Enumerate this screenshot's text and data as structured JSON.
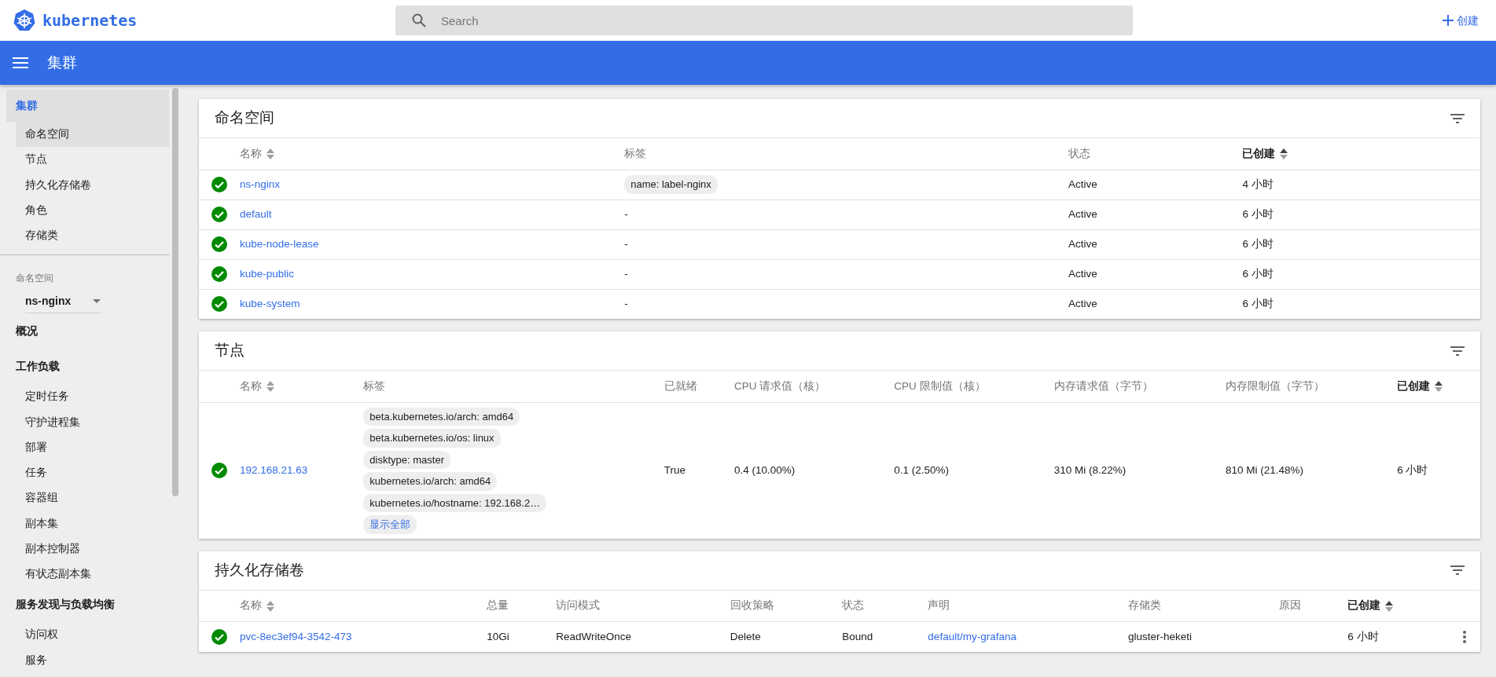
{
  "header": {
    "logo": "kubernetes",
    "search": {
      "placeholder": "Search"
    },
    "create_button": "创建"
  },
  "toolbar": {
    "title": "集群"
  },
  "sidebar": {
    "cluster": {
      "label": "集群",
      "selected": true,
      "items": [
        {
          "label": "命名空间",
          "selected": true
        },
        {
          "label": "节点",
          "selected": false
        },
        {
          "label": "持久化存储卷",
          "selected": false
        },
        {
          "label": "角色",
          "selected": false
        },
        {
          "label": "存储类",
          "selected": false
        }
      ]
    },
    "namespace_selector": {
      "label": "命名空间",
      "value": "ns-nginx"
    },
    "menu": [
      {
        "label": "概况",
        "selected": false
      },
      {
        "label": "工作负载",
        "selected": false,
        "items": [
          {
            "label": "定时任务",
            "selected": false
          },
          {
            "label": "守护进程集",
            "selected": false
          },
          {
            "label": "部署",
            "selected": false
          },
          {
            "label": "任务",
            "selected": false
          },
          {
            "label": "容器组",
            "selected": false
          },
          {
            "label": "副本集",
            "selected": false
          },
          {
            "label": "副本控制器",
            "selected": false
          },
          {
            "label": "有状态副本集",
            "selected": false
          }
        ]
      },
      {
        "label": "服务发现与负载均衡",
        "selected": false,
        "items": [
          {
            "label": "访问权",
            "selected": false
          },
          {
            "label": "服务",
            "selected": false
          }
        ]
      }
    ]
  },
  "cards": [
    {
      "title": "命名空间",
      "columns": [
        {
          "label": "名称",
          "sortable": true,
          "sorted": false
        },
        {
          "label": "标签",
          "sortable": false,
          "sorted": false
        },
        {
          "label": "状态",
          "sortable": false,
          "sorted": false
        },
        {
          "label": "已创建",
          "sortable": true,
          "sorted": true
        }
      ],
      "rows": [
        {
          "healthy": true,
          "cells": [
            {
              "kind": "link",
              "text": "ns-nginx"
            },
            {
              "kind": "chips",
              "chips": [
                "name: label-nginx"
              ]
            },
            {
              "kind": "text",
              "text": "Active"
            },
            {
              "kind": "text",
              "text": "4 小时"
            }
          ]
        },
        {
          "healthy": true,
          "cells": [
            {
              "kind": "link",
              "text": "default"
            },
            {
              "kind": "text",
              "text": "-"
            },
            {
              "kind": "text",
              "text": "Active"
            },
            {
              "kind": "text",
              "text": "6 小时"
            }
          ]
        },
        {
          "healthy": true,
          "cells": [
            {
              "kind": "link",
              "text": "kube-node-lease"
            },
            {
              "kind": "text",
              "text": "-"
            },
            {
              "kind": "text",
              "text": "Active"
            },
            {
              "kind": "text",
              "text": "6 小时"
            }
          ]
        },
        {
          "healthy": true,
          "cells": [
            {
              "kind": "link",
              "text": "kube-public"
            },
            {
              "kind": "text",
              "text": "-"
            },
            {
              "kind": "text",
              "text": "Active"
            },
            {
              "kind": "text",
              "text": "6 小时"
            }
          ]
        },
        {
          "healthy": true,
          "cells": [
            {
              "kind": "link",
              "text": "kube-system"
            },
            {
              "kind": "text",
              "text": "-"
            },
            {
              "kind": "text",
              "text": "Active"
            },
            {
              "kind": "text",
              "text": "6 小时"
            }
          ]
        }
      ]
    },
    {
      "title": "节点",
      "columns": [
        {
          "label": "名称",
          "sortable": true,
          "sorted": false
        },
        {
          "label": "标签",
          "sortable": false,
          "sorted": false
        },
        {
          "label": "已就绪",
          "sortable": false,
          "sorted": false
        },
        {
          "label": "CPU 请求值（核）",
          "sortable": false,
          "sorted": false
        },
        {
          "label": "CPU 限制值（核）",
          "sortable": false,
          "sorted": false
        },
        {
          "label": "内存请求值（字节）",
          "sortable": false,
          "sorted": false
        },
        {
          "label": "内存限制值（字节）",
          "sortable": false,
          "sorted": false
        },
        {
          "label": "已创建",
          "sortable": true,
          "sorted": true
        }
      ],
      "rows": [
        {
          "healthy": true,
          "cells": [
            {
              "kind": "link",
              "text": "192.168.21.63"
            },
            {
              "kind": "chips",
              "chips": [
                "beta.kubernetes.io/arch: amd64",
                "beta.kubernetes.io/os: linux",
                "disktype: master",
                "kubernetes.io/arch: amd64",
                "kubernetes.io/hostname: 192.168.2…"
              ],
              "more": "显示全部"
            },
            {
              "kind": "text",
              "text": "True"
            },
            {
              "kind": "text",
              "text": "0.4 (10.00%)"
            },
            {
              "kind": "text",
              "text": "0.1 (2.50%)"
            },
            {
              "kind": "text",
              "text": "310 Mi (8.22%)"
            },
            {
              "kind": "text",
              "text": "810 Mi (21.48%)"
            },
            {
              "kind": "text",
              "text": "6 小时"
            }
          ]
        }
      ]
    },
    {
      "title": "持久化存储卷",
      "columns": [
        {
          "label": "名称",
          "sortable": true,
          "sorted": false
        },
        {
          "label": "总量",
          "sortable": false,
          "sorted": false
        },
        {
          "label": "访问模式",
          "sortable": false,
          "sorted": false
        },
        {
          "label": "回收策略",
          "sortable": false,
          "sorted": false
        },
        {
          "label": "状态",
          "sortable": false,
          "sorted": false
        },
        {
          "label": "声明",
          "sortable": false,
          "sorted": false
        },
        {
          "label": "存储类",
          "sortable": false,
          "sorted": false
        },
        {
          "label": "原因",
          "sortable": false,
          "sorted": false
        },
        {
          "label": "已创建",
          "sortable": true,
          "sorted": true
        }
      ],
      "row_menu": true,
      "rows": [
        {
          "healthy": true,
          "cells": [
            {
              "kind": "link",
              "text": "pvc-8ec3ef94-3542-473"
            },
            {
              "kind": "text",
              "text": "10Gi"
            },
            {
              "kind": "text",
              "text": "ReadWriteOnce"
            },
            {
              "kind": "text",
              "text": "Delete"
            },
            {
              "kind": "text",
              "text": "Bound"
            },
            {
              "kind": "link",
              "text": "default/my-grafana"
            },
            {
              "kind": "text",
              "text": "gluster-heketi"
            },
            {
              "kind": "blank"
            },
            {
              "kind": "text",
              "text": "6 小时"
            }
          ]
        }
      ]
    }
  ]
}
